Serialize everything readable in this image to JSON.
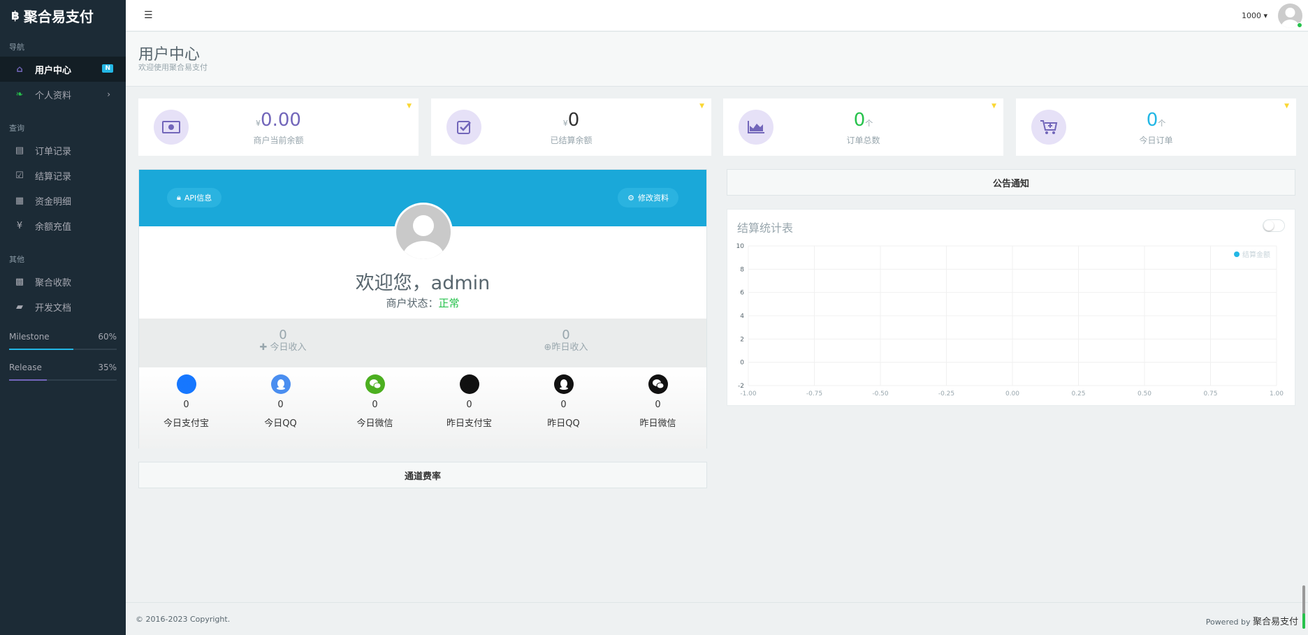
{
  "brand": {
    "title": "聚合易支付",
    "icon": "bitcoin-icon"
  },
  "sidebar": {
    "sections": [
      {
        "label": "导航"
      },
      {
        "label": "查询"
      },
      {
        "label": "其他"
      }
    ],
    "items": [
      {
        "label": "用户中心",
        "icon": "home-icon",
        "badge": "N"
      },
      {
        "label": "个人资料",
        "icon": "leaf-icon",
        "chevron": "›"
      },
      {
        "label": "订单记录",
        "icon": "list-icon"
      },
      {
        "label": "结算记录",
        "icon": "check-square-icon"
      },
      {
        "label": "资金明细",
        "icon": "calendar-icon"
      },
      {
        "label": "余额充值",
        "icon": "yen-icon"
      },
      {
        "label": "聚合收款",
        "icon": "qrcode-icon"
      },
      {
        "label": "开发文档",
        "icon": "book-icon"
      }
    ],
    "progress": [
      {
        "label": "Milestone",
        "percent_text": "60%",
        "value": 0.6,
        "color": "#23b7e5"
      },
      {
        "label": "Release",
        "percent_text": "35%",
        "value": 0.35,
        "color": "#7266ba"
      }
    ]
  },
  "header": {
    "menu_icon": "menu-icon",
    "user_name": "1000 ▾"
  },
  "page": {
    "title": "用户中心",
    "subtitle": "欢迎使用聚合易支付"
  },
  "stats": [
    {
      "prefix": "¥",
      "value": "0.00",
      "suffix": "",
      "label": "商户当前余额",
      "icon": "money-icon"
    },
    {
      "prefix": "¥",
      "value": "0",
      "suffix": "",
      "label": "已结算余额",
      "icon": "check-icon"
    },
    {
      "prefix": "",
      "value": "0",
      "suffix": "个",
      "label": "订单总数",
      "icon": "area-chart-icon"
    },
    {
      "prefix": "",
      "value": "0",
      "suffix": "个",
      "label": "今日订单",
      "icon": "cart-icon"
    }
  ],
  "profile": {
    "api_button": "API信息",
    "edit_button": "修改资料",
    "welcome": "欢迎您，admin",
    "status_label": "商户状态：",
    "status_value": "正常",
    "today_income": {
      "value": "0",
      "label": "今日收入"
    },
    "yesterday_income": {
      "value": "0",
      "label": "昨日收入"
    },
    "channels": [
      {
        "value": "0",
        "label": "今日支付宝",
        "icon": "alipay-icon",
        "color": "#1677ff",
        "glyph": "支"
      },
      {
        "value": "0",
        "label": "今日QQ",
        "icon": "qq-icon",
        "color": "#4a8ef0",
        "glyph": ""
      },
      {
        "value": "0",
        "label": "今日微信",
        "icon": "wechat-icon",
        "color": "#4caf20",
        "glyph": ""
      },
      {
        "value": "0",
        "label": "昨日支付宝",
        "icon": "alipay-icon",
        "color": "#111111",
        "glyph": "支"
      },
      {
        "value": "0",
        "label": "昨日QQ",
        "icon": "qq-icon",
        "color": "#111111",
        "glyph": ""
      },
      {
        "value": "0",
        "label": "昨日微信",
        "icon": "wechat-icon",
        "color": "#111111",
        "glyph": ""
      }
    ]
  },
  "panels": {
    "rates": "通道费率",
    "notice": "公告通知"
  },
  "chart_data": {
    "type": "line",
    "title": "结算统计表",
    "x_ticks": [
      "-1.00",
      "-0.75",
      "-0.50",
      "-0.25",
      "0.00",
      "0.25",
      "0.50",
      "0.75",
      "1.00"
    ],
    "y_ticks": [
      "10",
      "8",
      "6",
      "4",
      "2",
      "0",
      "-2"
    ],
    "xlim": [
      -1,
      1
    ],
    "ylim": [
      -2,
      10
    ],
    "grid": true,
    "legend_position": "top-right",
    "series": [
      {
        "name": "结算金额",
        "color": "#23b7e5",
        "values": []
      }
    ]
  },
  "footer": {
    "copyright": "© 2016-2023 Copyright.",
    "powered_prefix": "Powered by ",
    "powered_brand": "聚合易支付"
  }
}
